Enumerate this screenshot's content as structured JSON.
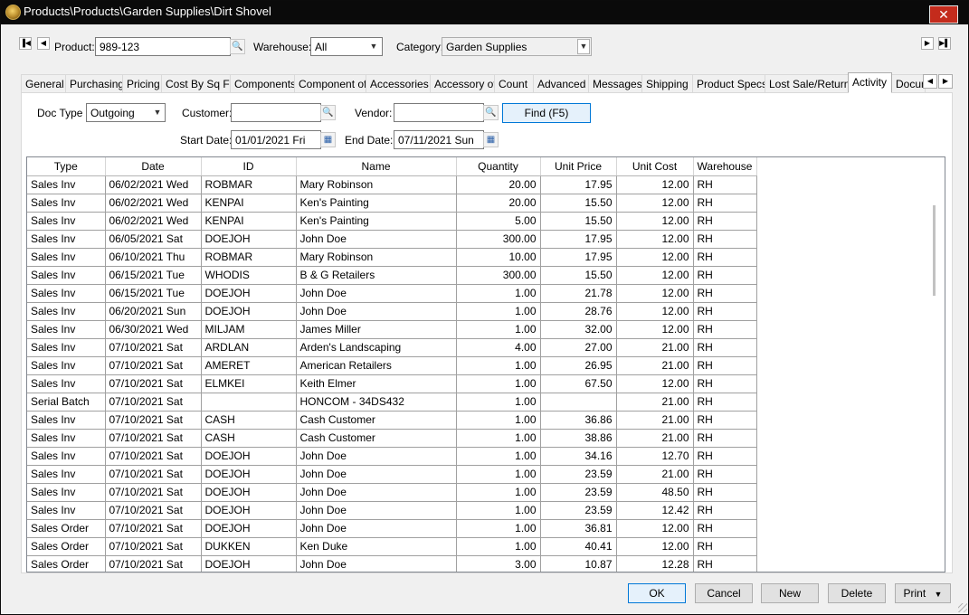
{
  "window": {
    "title": "Products\\Products\\Garden Supplies\\Dirt Shovel",
    "close_symbol": "✕"
  },
  "header": {
    "product_label": "Product:",
    "product_value": "989-123",
    "warehouse_label": "Warehouse:",
    "warehouse_value": "All",
    "category_label": "Category:",
    "category_value": "Garden Supplies"
  },
  "tabs": [
    {
      "label": "General"
    },
    {
      "label": "Purchasing"
    },
    {
      "label": "Pricing"
    },
    {
      "label": "Cost By Sq Ft"
    },
    {
      "label": "Components"
    },
    {
      "label": "Component of"
    },
    {
      "label": "Accessories"
    },
    {
      "label": "Accessory of"
    },
    {
      "label": "Count"
    },
    {
      "label": "Advanced"
    },
    {
      "label": "Messages"
    },
    {
      "label": "Shipping"
    },
    {
      "label": "Product Specs"
    },
    {
      "label": "Lost Sale/Return"
    },
    {
      "label": "Activity"
    },
    {
      "label": "Docum"
    }
  ],
  "active_tab": "Activity",
  "filters": {
    "doc_type_label": "Doc Type",
    "doc_type_value": "Outgoing",
    "customer_label": "Customer:",
    "customer_value": "",
    "vendor_label": "Vendor:",
    "vendor_value": "",
    "find_label": "Find (F5)",
    "start_date_label": "Start Date:",
    "start_date_value": "01/01/2021 Fri",
    "end_date_label": "End Date:",
    "end_date_value": "07/11/2021 Sun"
  },
  "grid": {
    "columns": [
      "Type",
      "Date",
      "ID",
      "Name",
      "Quantity",
      "Unit Price",
      "Unit Cost",
      "Warehouse"
    ],
    "rows": [
      [
        "Sales Inv",
        "06/02/2021 Wed",
        "ROBMAR",
        "Mary Robinson",
        "20.00",
        "17.95",
        "12.00",
        "RH"
      ],
      [
        "Sales Inv",
        "06/02/2021 Wed",
        "KENPAI",
        "Ken's Painting",
        "20.00",
        "15.50",
        "12.00",
        "RH"
      ],
      [
        "Sales Inv",
        "06/02/2021 Wed",
        "KENPAI",
        "Ken's Painting",
        "5.00",
        "15.50",
        "12.00",
        "RH"
      ],
      [
        "Sales Inv",
        "06/05/2021 Sat",
        "DOEJOH",
        "John Doe",
        "300.00",
        "17.95",
        "12.00",
        "RH"
      ],
      [
        "Sales Inv",
        "06/10/2021 Thu",
        "ROBMAR",
        "Mary Robinson",
        "10.00",
        "17.95",
        "12.00",
        "RH"
      ],
      [
        "Sales Inv",
        "06/15/2021 Tue",
        "WHODIS",
        "B & G Retailers",
        "300.00",
        "15.50",
        "12.00",
        "RH"
      ],
      [
        "Sales Inv",
        "06/15/2021 Tue",
        "DOEJOH",
        "John Doe",
        "1.00",
        "21.78",
        "12.00",
        "RH"
      ],
      [
        "Sales Inv",
        "06/20/2021 Sun",
        "DOEJOH",
        "John Doe",
        "1.00",
        "28.76",
        "12.00",
        "RH"
      ],
      [
        "Sales Inv",
        "06/30/2021 Wed",
        "MILJAM",
        "James Miller",
        "1.00",
        "32.00",
        "12.00",
        "RH"
      ],
      [
        "Sales Inv",
        "07/10/2021 Sat",
        "ARDLAN",
        "Arden's Landscaping",
        "4.00",
        "27.00",
        "21.00",
        "RH"
      ],
      [
        "Sales Inv",
        "07/10/2021 Sat",
        "AMERET",
        "American Retailers",
        "1.00",
        "26.95",
        "21.00",
        "RH"
      ],
      [
        "Sales Inv",
        "07/10/2021 Sat",
        "ELMKEI",
        "Keith Elmer",
        "1.00",
        "67.50",
        "12.00",
        "RH"
      ],
      [
        "Serial Batch",
        "07/10/2021 Sat",
        "",
        "HONCOM - 34DS432",
        "1.00",
        "",
        "21.00",
        "RH"
      ],
      [
        "Sales Inv",
        "07/10/2021 Sat",
        "CASH",
        "Cash Customer",
        "1.00",
        "36.86",
        "21.00",
        "RH"
      ],
      [
        "Sales Inv",
        "07/10/2021 Sat",
        "CASH",
        "Cash Customer",
        "1.00",
        "38.86",
        "21.00",
        "RH"
      ],
      [
        "Sales Inv",
        "07/10/2021 Sat",
        "DOEJOH",
        "John Doe",
        "1.00",
        "34.16",
        "12.70",
        "RH"
      ],
      [
        "Sales Inv",
        "07/10/2021 Sat",
        "DOEJOH",
        "John Doe",
        "1.00",
        "23.59",
        "21.00",
        "RH"
      ],
      [
        "Sales Inv",
        "07/10/2021 Sat",
        "DOEJOH",
        "John Doe",
        "1.00",
        "23.59",
        "48.50",
        "RH"
      ],
      [
        "Sales Inv",
        "07/10/2021 Sat",
        "DOEJOH",
        "John Doe",
        "1.00",
        "23.59",
        "12.42",
        "RH"
      ],
      [
        "Sales Order",
        "07/10/2021 Sat",
        "DOEJOH",
        "John Doe",
        "1.00",
        "36.81",
        "12.00",
        "RH"
      ],
      [
        "Sales Order",
        "07/10/2021 Sat",
        "DUKKEN",
        "Ken Duke",
        "1.00",
        "40.41",
        "12.00",
        "RH"
      ],
      [
        "Sales Order",
        "07/10/2021 Sat",
        "DOEJOH",
        "John Doe",
        "3.00",
        "10.87",
        "12.28",
        "RH"
      ]
    ]
  },
  "footer": {
    "ok_label": "OK",
    "cancel_label": "Cancel",
    "new_label": "New",
    "delete_label": "Delete",
    "print_label": "Print"
  },
  "colors": {
    "titlebar": "#0a0a0a",
    "close": "#c42b1c",
    "focus": "#0078d7"
  }
}
